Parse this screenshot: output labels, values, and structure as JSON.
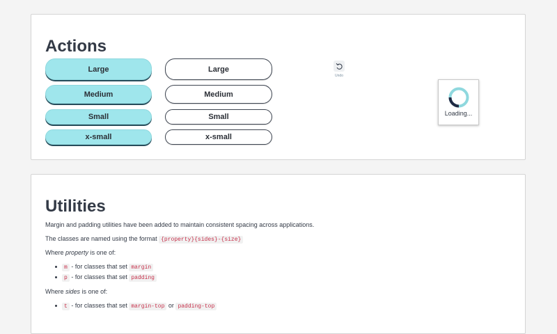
{
  "actions": {
    "title": "Actions",
    "filled_buttons": [
      "Large",
      "Medium",
      "Small",
      "x-small"
    ],
    "outline_buttons": [
      "Large",
      "Medium",
      "Small",
      "x-small"
    ],
    "undo": {
      "icon": "undo-icon",
      "label": "Undo"
    },
    "loader": {
      "text": "Loading...",
      "progress": 0.75
    }
  },
  "utilities": {
    "title": "Utilities",
    "intro": "Margin and padding utilities have been added to maintain consistent spacing across applications.",
    "format_prefix": "The classes are named using the format",
    "format_code": "{property}{sides}-{size}",
    "where_prefix": "Where",
    "property_word": "property",
    "is_one_of": "is one of:",
    "property_items": [
      {
        "code": "m",
        "text": "- for classes that set",
        "code2": "margin"
      },
      {
        "code": "p",
        "text": "- for classes that set",
        "code2": "padding"
      }
    ],
    "sides_word": "sides",
    "sides_items": [
      {
        "code": "t",
        "text": "- for classes that set",
        "code2": "margin-top",
        "or": "or",
        "code3": "padding-top"
      }
    ]
  },
  "colors": {
    "accent": "#9fe6ec",
    "accent_shadow": "#274c5a",
    "code_text": "#c7304a",
    "spinner_dark": "#1f2a44",
    "spinner_light": "#8fd8de"
  }
}
